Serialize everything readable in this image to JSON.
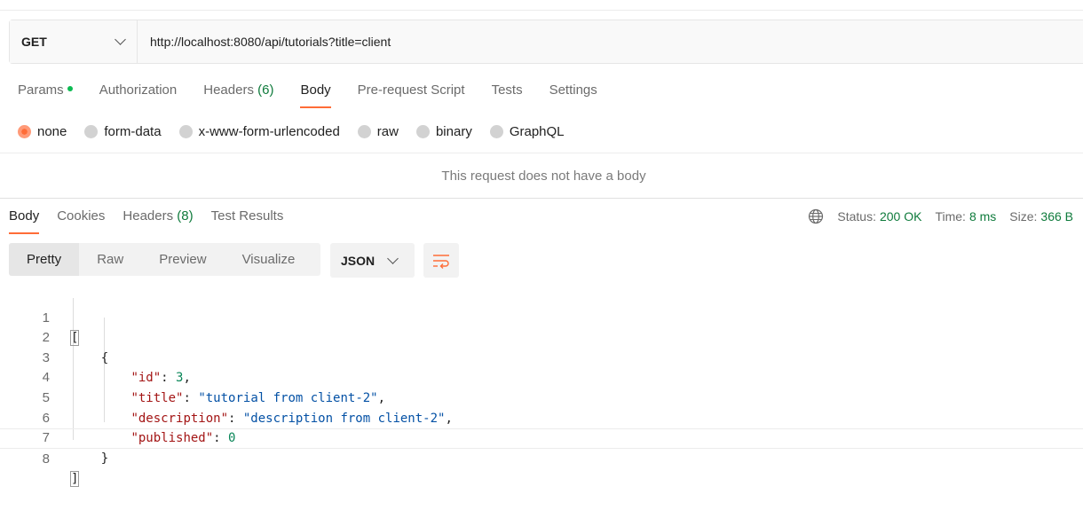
{
  "request": {
    "method": "GET",
    "url": "http://localhost:8080/api/tutorials?title=client"
  },
  "request_tabs": [
    {
      "label": "Params",
      "has_dot": true
    },
    {
      "label": "Authorization"
    },
    {
      "label": "Headers",
      "count": "(6)"
    },
    {
      "label": "Body",
      "active": true
    },
    {
      "label": "Pre-request Script"
    },
    {
      "label": "Tests"
    },
    {
      "label": "Settings"
    }
  ],
  "body_types": [
    "none",
    "form-data",
    "x-www-form-urlencoded",
    "raw",
    "binary",
    "GraphQL"
  ],
  "body_selected": "none",
  "no_body_message": "This request does not have a body",
  "response_tabs": [
    {
      "label": "Body",
      "active": true
    },
    {
      "label": "Cookies"
    },
    {
      "label": "Headers",
      "count": "(8)"
    },
    {
      "label": "Test Results"
    }
  ],
  "status": {
    "status_label": "Status:",
    "status_value": "200 OK",
    "time_label": "Time:",
    "time_value": "8 ms",
    "size_label": "Size:",
    "size_value": "366 B"
  },
  "view_modes": [
    "Pretty",
    "Raw",
    "Preview",
    "Visualize"
  ],
  "format": "JSON",
  "code_lines": [
    {
      "n": "1",
      "text": "["
    },
    {
      "n": "2",
      "text": "    {"
    },
    {
      "n": "3",
      "key": "\"id\"",
      "sep": ": ",
      "value": "3",
      "vtype": "num",
      "trail": ","
    },
    {
      "n": "4",
      "key": "\"title\"",
      "sep": ": ",
      "value": "\"tutorial from client-2\"",
      "vtype": "str",
      "trail": ","
    },
    {
      "n": "5",
      "key": "\"description\"",
      "sep": ": ",
      "value": "\"description from client-2\"",
      "vtype": "str",
      "trail": ","
    },
    {
      "n": "6",
      "key": "\"published\"",
      "sep": ": ",
      "value": "0",
      "vtype": "num",
      "trail": ""
    },
    {
      "n": "7",
      "text": "    }"
    },
    {
      "n": "8",
      "text": "]"
    }
  ],
  "colors": {
    "accent": "#ff6c37",
    "success": "#0f7b3c"
  },
  "icons": {
    "method_dropdown": "chevron-down-icon",
    "format_dropdown": "chevron-down-icon",
    "wrap": "wrap-lines-icon",
    "network": "globe-icon"
  }
}
